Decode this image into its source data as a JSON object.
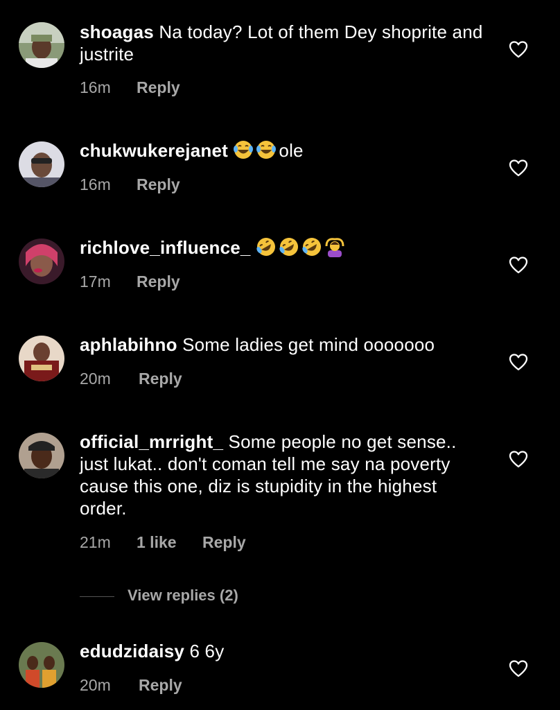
{
  "comments": [
    {
      "username": "shoagas",
      "text": "Na today? Lot of them Dey shoprite and justrite",
      "emojis": [],
      "time": "16m",
      "likes": "",
      "reply": "Reply",
      "avatar_color": "#7a8a60"
    },
    {
      "username": "chukwukerejanet",
      "text": "ole",
      "emojis": [
        "face-with-tears-of-joy",
        "face-with-tears-of-joy"
      ],
      "time": "16m",
      "likes": "",
      "reply": "Reply",
      "avatar_color": "#c8c8d0"
    },
    {
      "username": "richlove_influence_",
      "text": "",
      "emojis": [
        "rolling-on-floor-laughing",
        "rolling-on-floor-laughing",
        "rolling-on-floor-laughing",
        "person-gesturing-ok"
      ],
      "time": "17m",
      "likes": "",
      "reply": "Reply",
      "avatar_color": "#c05070"
    },
    {
      "username": "aphlabihno",
      "text": "Some ladies get mind ooooooo",
      "emojis": [],
      "time": "20m",
      "likes": "",
      "reply": "Reply",
      "avatar_color": "#b07050"
    },
    {
      "username": "official_mrright_",
      "text": "Some people no get sense.. just lukat.. don't coman tell me say na poverty cause this one, diz is stupidity in the highest order.",
      "emojis": [],
      "time": "21m",
      "likes": "1 like",
      "reply": "Reply",
      "avatar_color": "#a09080"
    },
    {
      "username": "edudzidaisy",
      "text": "6 6y",
      "emojis": [],
      "time": "20m",
      "likes": "",
      "reply": "Reply",
      "avatar_color": "#c09040"
    }
  ],
  "view_replies": "View replies (2)",
  "colors": {
    "background": "#000000",
    "text": "#ffffff",
    "meta": "#a8a8a8",
    "emoji_yellow": "#f5c33b",
    "emoji_purple": "#9b4dca"
  }
}
